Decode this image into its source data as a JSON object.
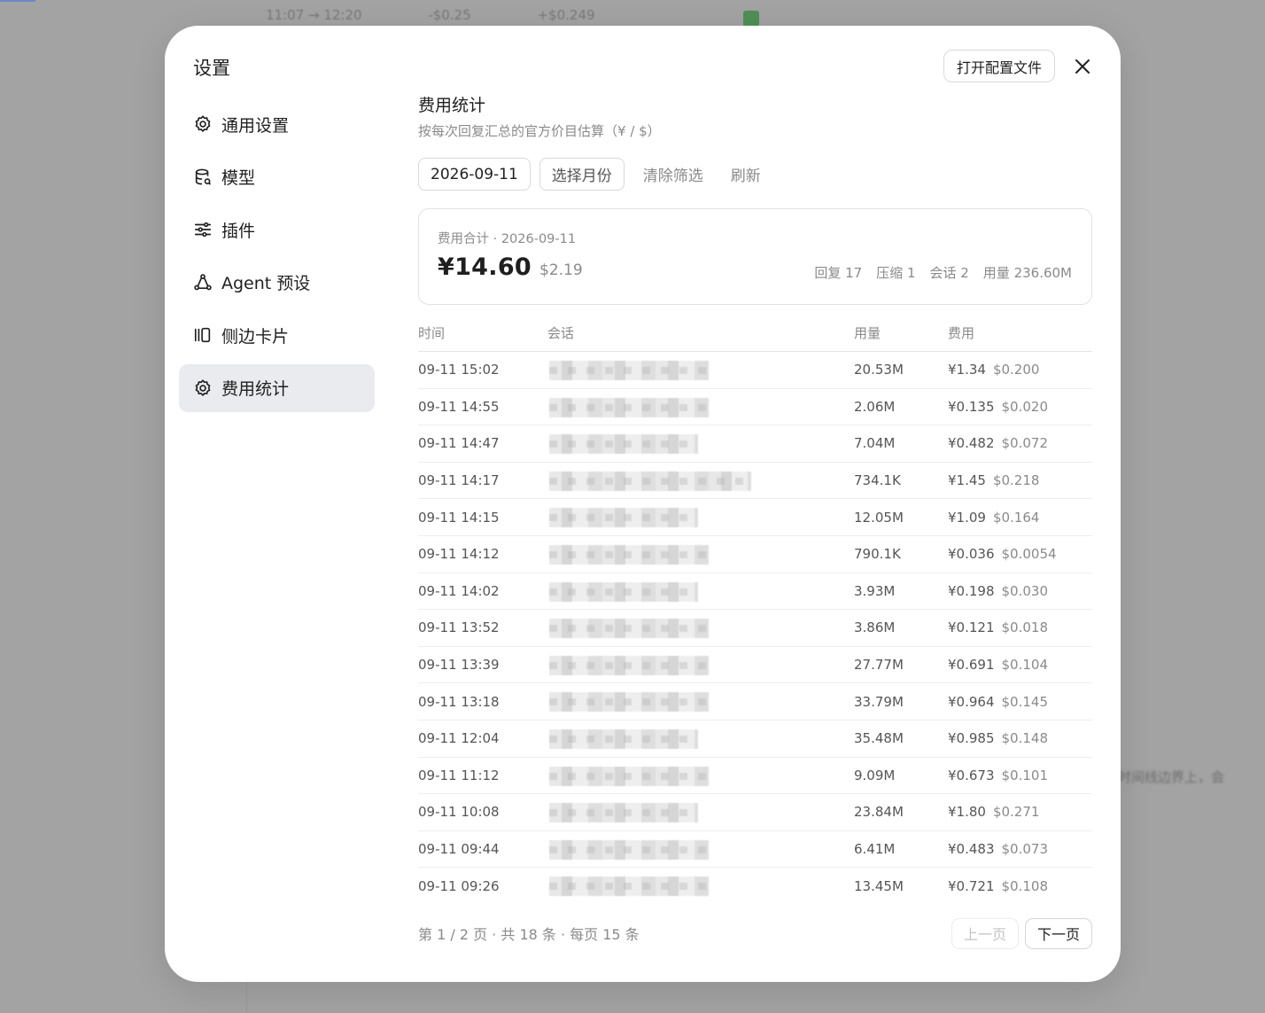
{
  "background": {
    "strip": [
      "11:07 → 12:20",
      "-$0.25",
      "+$0.249"
    ],
    "right_text": "时间线边界上，会"
  },
  "modal": {
    "title": "设置",
    "open_config_label": "打开配置文件",
    "close_icon": "close-icon"
  },
  "sidebar": {
    "items": [
      {
        "label": "通用设置",
        "icon": "gear-icon"
      },
      {
        "label": "模型",
        "icon": "database-icon"
      },
      {
        "label": "插件",
        "icon": "sliders-icon"
      },
      {
        "label": "Agent 预设",
        "icon": "agent-icon"
      },
      {
        "label": "侧边卡片",
        "icon": "cards-icon"
      },
      {
        "label": "费用统计",
        "icon": "gear-icon",
        "active": true
      }
    ]
  },
  "main": {
    "title": "费用统计",
    "subtitle": "按每次回复汇总的官方价目估算（¥ / $）",
    "toolbar": {
      "date": "2026-09-11",
      "select_month": "选择月份",
      "clear_filter": "清除筛选",
      "refresh": "刷新"
    },
    "summary": {
      "label": "费用合计 · 2026-09-11",
      "cny": "¥14.60",
      "usd": "$2.19",
      "replies": "回复 17",
      "compress": "压缩 1",
      "sessions": "会话 2",
      "usage": "用量 236.60M"
    },
    "table": {
      "headers": {
        "time": "时间",
        "session": "会话",
        "usage": "用量",
        "fee": "费用"
      },
      "rows": [
        {
          "time": "09-11 15:02",
          "usage": "20.53M",
          "cny": "¥1.34",
          "usd": "$0.200"
        },
        {
          "time": "09-11 14:55",
          "usage": "2.06M",
          "cny": "¥0.135",
          "usd": "$0.020"
        },
        {
          "time": "09-11 14:47",
          "usage": "7.04M",
          "cny": "¥0.482",
          "usd": "$0.072"
        },
        {
          "time": "09-11 14:17",
          "usage": "734.1K",
          "cny": "¥1.45",
          "usd": "$0.218"
        },
        {
          "time": "09-11 14:15",
          "usage": "12.05M",
          "cny": "¥1.09",
          "usd": "$0.164"
        },
        {
          "time": "09-11 14:12",
          "usage": "790.1K",
          "cny": "¥0.036",
          "usd": "$0.0054"
        },
        {
          "time": "09-11 14:02",
          "usage": "3.93M",
          "cny": "¥0.198",
          "usd": "$0.030"
        },
        {
          "time": "09-11 13:52",
          "usage": "3.86M",
          "cny": "¥0.121",
          "usd": "$0.018"
        },
        {
          "time": "09-11 13:39",
          "usage": "27.77M",
          "cny": "¥0.691",
          "usd": "$0.104"
        },
        {
          "time": "09-11 13:18",
          "usage": "33.79M",
          "cny": "¥0.964",
          "usd": "$0.145"
        },
        {
          "time": "09-11 12:04",
          "usage": "35.48M",
          "cny": "¥0.985",
          "usd": "$0.148"
        },
        {
          "time": "09-11 11:12",
          "usage": "9.09M",
          "cny": "¥0.673",
          "usd": "$0.101"
        },
        {
          "time": "09-11 10:08",
          "usage": "23.84M",
          "cny": "¥1.80",
          "usd": "$0.271"
        },
        {
          "time": "09-11 09:44",
          "usage": "6.41M",
          "cny": "¥0.483",
          "usd": "$0.073"
        },
        {
          "time": "09-11 09:26",
          "usage": "13.45M",
          "cny": "¥0.721",
          "usd": "$0.108"
        }
      ]
    },
    "pager": {
      "info": "第 1 / 2 页 · 共 18 条 · 每页 15 条",
      "prev": "上一页",
      "next": "下一页"
    }
  }
}
